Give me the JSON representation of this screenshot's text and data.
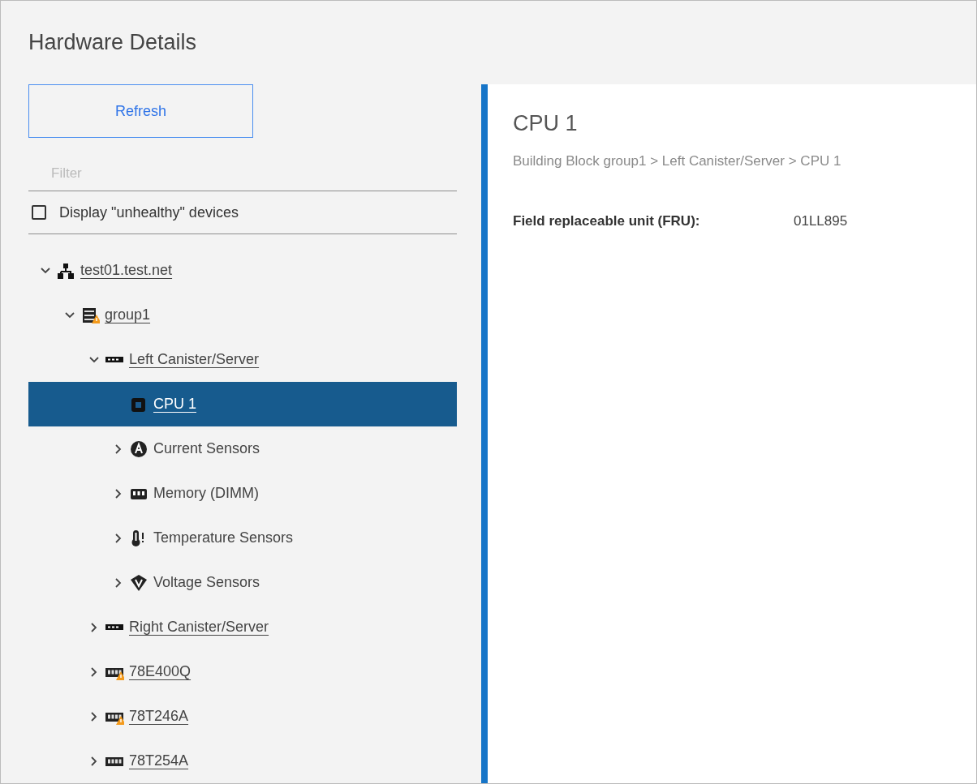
{
  "page_title": "Hardware Details",
  "refresh_button": "Refresh",
  "filter": {
    "placeholder": "Filter"
  },
  "unhealthy_checkbox": {
    "label": "Display \"unhealthy\" devices",
    "checked": false
  },
  "tree": [
    {
      "label": "test01.test.net",
      "kind": "network",
      "link": true,
      "warning": false,
      "selected": false,
      "expanded": true,
      "children": [
        {
          "label": "group1",
          "kind": "rack",
          "link": true,
          "warning": true,
          "selected": false,
          "expanded": true,
          "children": [
            {
              "label": "Left Canister/Server",
              "kind": "canister",
              "link": true,
              "warning": false,
              "selected": false,
              "expanded": true,
              "children": [
                {
                  "label": "CPU 1",
                  "kind": "cpu",
                  "link": true,
                  "warning": false,
                  "selected": true
                },
                {
                  "label": "Current Sensors",
                  "kind": "current",
                  "link": false,
                  "warning": false,
                  "selected": false,
                  "expanded": false
                },
                {
                  "label": "Memory (DIMM)",
                  "kind": "memory",
                  "link": false,
                  "warning": false,
                  "selected": false,
                  "expanded": false
                },
                {
                  "label": "Temperature Sensors",
                  "kind": "temperature",
                  "link": false,
                  "warning": false,
                  "selected": false,
                  "expanded": false
                },
                {
                  "label": "Voltage Sensors",
                  "kind": "voltage",
                  "link": false,
                  "warning": false,
                  "selected": false,
                  "expanded": false
                }
              ]
            },
            {
              "label": "Right Canister/Server",
              "kind": "canister",
              "link": true,
              "warning": false,
              "selected": false,
              "expanded": false
            },
            {
              "label": "78E400Q",
              "kind": "enclosure",
              "link": true,
              "warning": true,
              "selected": false,
              "expanded": false
            },
            {
              "label": "78T246A",
              "kind": "enclosure",
              "link": true,
              "warning": true,
              "selected": false,
              "expanded": false
            },
            {
              "label": "78T254A",
              "kind": "enclosure",
              "link": true,
              "warning": false,
              "selected": false,
              "expanded": false
            }
          ]
        }
      ]
    }
  ],
  "detail": {
    "title": "CPU 1",
    "breadcrumb": "Building Block group1 > Left Canister/Server > CPU 1",
    "fields": [
      {
        "label": "Field replaceable unit (FRU):",
        "value": "01LL895"
      }
    ]
  }
}
